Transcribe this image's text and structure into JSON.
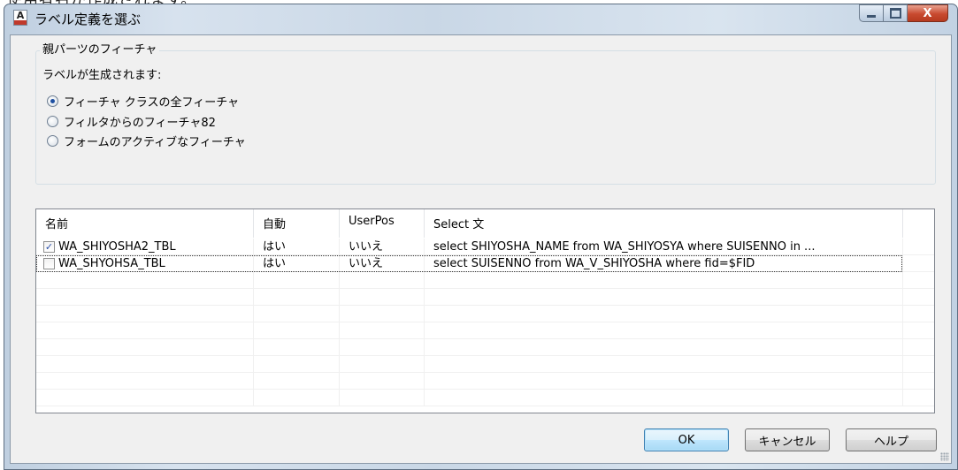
{
  "background_text": "使用者名が作成されます。",
  "window": {
    "title": "ラベル定義を選ぶ",
    "icon": "app-icon",
    "icon_glyph": "A",
    "close_glyph": "X"
  },
  "group": {
    "legend": "親パーツのフィーチャ",
    "label": "ラベルが生成されます:",
    "options": [
      {
        "label": "フィーチャ クラスの全フィーチャ",
        "checked": true
      },
      {
        "label": "フィルタからのフィーチャ82",
        "checked": false
      },
      {
        "label": "フォームのアクティブなフィーチャ",
        "checked": false
      }
    ]
  },
  "list": {
    "columns": [
      "名前",
      "自動",
      "UserPos",
      "Select 文"
    ],
    "rows": [
      {
        "checked": true,
        "name": "WA_SHIYOSHA2_TBL",
        "auto": "はい",
        "userpos": "いいえ",
        "select": "select SHIYOSHA_NAME from WA_SHIYOSYA   where SUISENNO in ..."
      },
      {
        "checked": false,
        "name": "WA_SHYOHSA_TBL",
        "auto": "はい",
        "userpos": "いいえ",
        "select": "select SUISENNO from WA_V_SHIYOSHA where fid=$FID"
      }
    ],
    "check_glyph": "✓"
  },
  "buttons": {
    "ok": "OK",
    "cancel": "キャンセル",
    "help": "ヘルプ"
  }
}
